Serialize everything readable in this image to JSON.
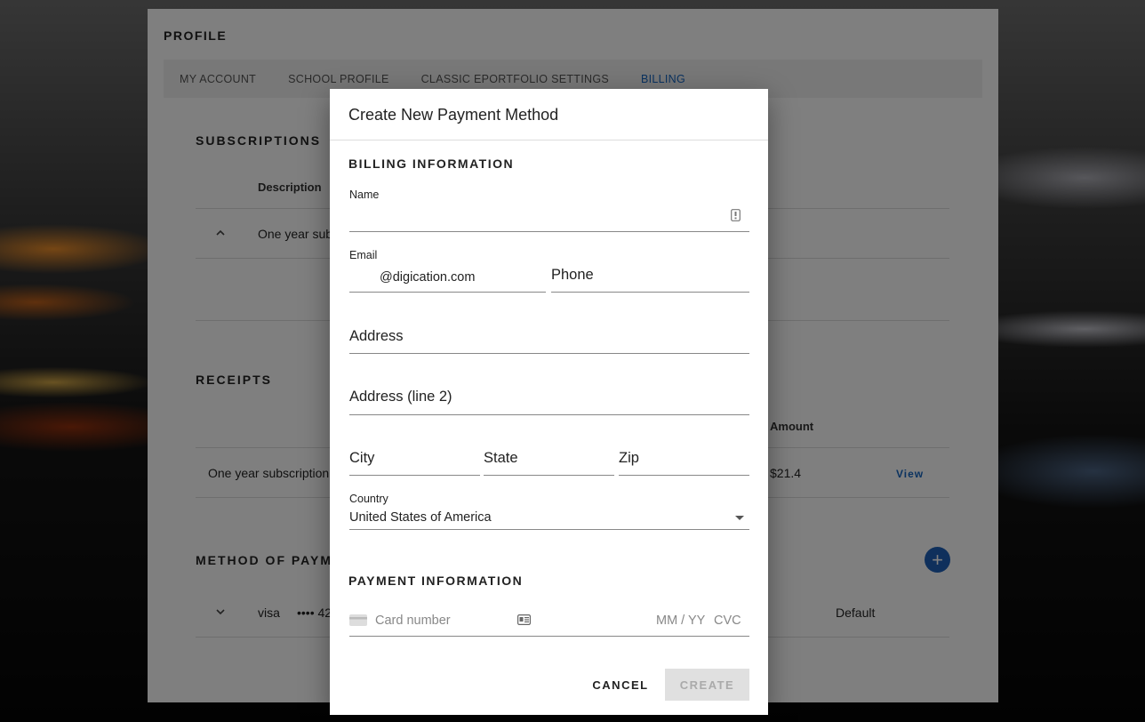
{
  "page": {
    "title": "PROFILE",
    "tabs": [
      {
        "label": "MY ACCOUNT"
      },
      {
        "label": "SCHOOL PROFILE"
      },
      {
        "label": "CLASSIC EPORTFOLIO SETTINGS"
      },
      {
        "label": "BILLING"
      }
    ],
    "subscriptions": {
      "title": "SUBSCRIPTIONS",
      "header_description": "Description",
      "row_description": "One year sub"
    },
    "receipts": {
      "title": "RECEIPTS",
      "header_amount": "Amount",
      "row_description": "One year subscription",
      "row_amount": "$21.4",
      "row_view": "View"
    },
    "method_of_payment": {
      "title": "METHOD OF PAYM",
      "card_brand": "visa",
      "card_masked": "•••• 42",
      "default_label": "Default"
    }
  },
  "dialog": {
    "title": "Create New Payment Method",
    "billing_section": "BILLING INFORMATION",
    "name_label": "Name",
    "email_label": "Email",
    "email_value": "@digication.com",
    "phone_placeholder": "Phone",
    "address_placeholder": "Address",
    "address2_placeholder": "Address (line 2)",
    "city_placeholder": "City",
    "state_placeholder": "State",
    "zip_placeholder": "Zip",
    "country_label": "Country",
    "country_value": "United States of America",
    "payment_section": "PAYMENT INFORMATION",
    "card_number_placeholder": "Card number",
    "expiry_placeholder": "MM / YY",
    "cvc_placeholder": "CVC",
    "cancel_label": "CANCEL",
    "create_label": "CREATE"
  },
  "colors": {
    "accent": "#1565c0",
    "fab": "#1e60b8",
    "disabled_bg": "#e0e0e0"
  }
}
